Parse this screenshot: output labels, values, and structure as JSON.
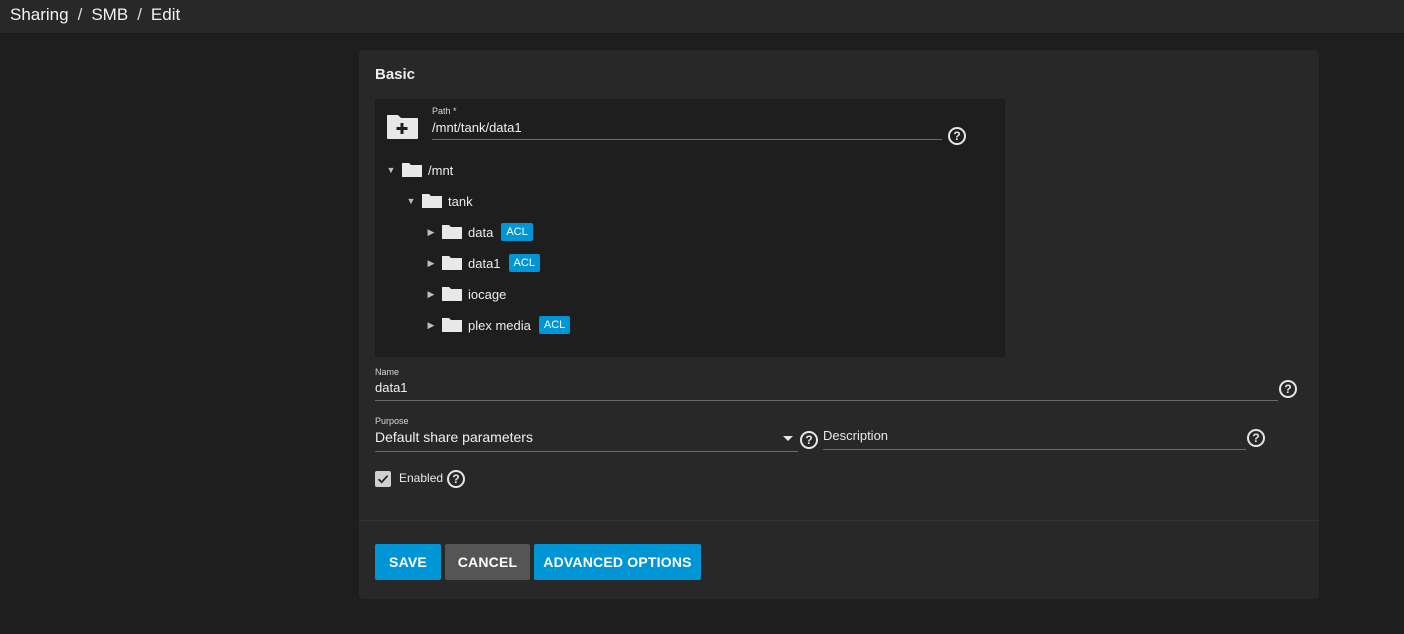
{
  "breadcrumb": {
    "items": [
      "Sharing",
      "SMB",
      "Edit"
    ],
    "separator": "/"
  },
  "card": {
    "title": "Basic"
  },
  "path": {
    "label": "Path *",
    "value": "/mnt/tank/data1"
  },
  "tree": [
    {
      "name": "/mnt",
      "expanded": true,
      "level": 0,
      "acl": ""
    },
    {
      "name": "tank",
      "expanded": true,
      "level": 1,
      "acl": ""
    },
    {
      "name": "data",
      "expanded": false,
      "level": 2,
      "acl": "ACL"
    },
    {
      "name": "data1",
      "expanded": false,
      "level": 2,
      "acl": "ACL"
    },
    {
      "name": "iocage",
      "expanded": false,
      "level": 2,
      "acl": ""
    },
    {
      "name": "plex media",
      "expanded": false,
      "level": 2,
      "acl": "ACL"
    }
  ],
  "name_field": {
    "label": "Name",
    "value": "data1"
  },
  "purpose_field": {
    "label": "Purpose",
    "value": "Default share parameters"
  },
  "description_field": {
    "placeholder": "Description"
  },
  "enabled": {
    "label": "Enabled",
    "checked": true
  },
  "buttons": {
    "save": "SAVE",
    "cancel": "CANCEL",
    "advanced": "ADVANCED OPTIONS"
  },
  "help_glyph": "?",
  "colors": {
    "accent": "#0095d5",
    "cancel": "#555555",
    "card": "#282828",
    "background": "#1e1e1e"
  },
  "icons": {
    "folder_add": "folder-plus-icon",
    "folder": "folder-icon",
    "help": "help-circle-icon",
    "check": "check-icon"
  }
}
